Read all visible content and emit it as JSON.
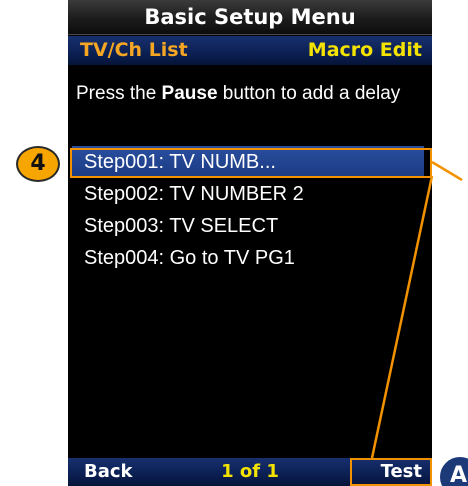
{
  "title": "Basic Setup Menu",
  "header": {
    "left": "TV/Ch List",
    "right": "Macro Edit"
  },
  "instruction": {
    "prefix": "Press the ",
    "bold": "Pause",
    "suffix": " button to add a delay"
  },
  "steps": [
    {
      "label": "Step001: TV NUMB..."
    },
    {
      "label": "Step002: TV NUMBER 2"
    },
    {
      "label": "Step003: TV SELECT"
    },
    {
      "label": "Step004: Go to TV PG1"
    }
  ],
  "footer": {
    "back": "Back",
    "page": "1 of 1",
    "test": "Test"
  },
  "annotations": {
    "badge_step": "4",
    "badge_test": "A"
  },
  "colors": {
    "accent_orange": "#f39200",
    "header_orange_text": "#f5a623",
    "header_yellow_text": "#f4e300",
    "selection_blue": "#1b3a82",
    "bar_blue": "#0b1f52"
  }
}
